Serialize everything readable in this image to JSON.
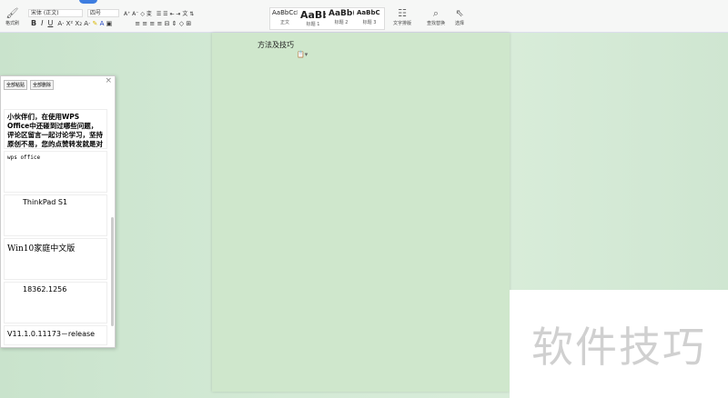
{
  "ribbon": {
    "format_painter": "格式刷",
    "font_name": "宋体 (正文)",
    "font_size": "四号",
    "bold": "B",
    "italic": "I",
    "underline": "U",
    "styles": [
      {
        "preview": "AaBbCcI",
        "name": "正文"
      },
      {
        "preview": "AaBb",
        "name": "标题 1"
      },
      {
        "preview": "AaBb(",
        "name": "标题 2"
      },
      {
        "preview": "AaBbC",
        "name": "标题 3"
      }
    ],
    "text_layout": "文字排版",
    "find_replace": "查找替换",
    "select": "选择"
  },
  "document": {
    "text": "方法及技巧"
  },
  "clipboard": {
    "paste_all": "全部粘贴",
    "delete_all": "全部删除",
    "close": "×",
    "items": [
      "小伙伴们，在使用WPS Office中还碰到过哪些问题，评论区留言一起讨论学习，坚持原创不易，您的点赞转发就是对小编最大的",
      "wps office",
      "ThinkPad S1",
      "Win10家庭中文版",
      "18362.1256",
      "V11.1.0.11173－release"
    ]
  },
  "watermark": "软件技巧"
}
